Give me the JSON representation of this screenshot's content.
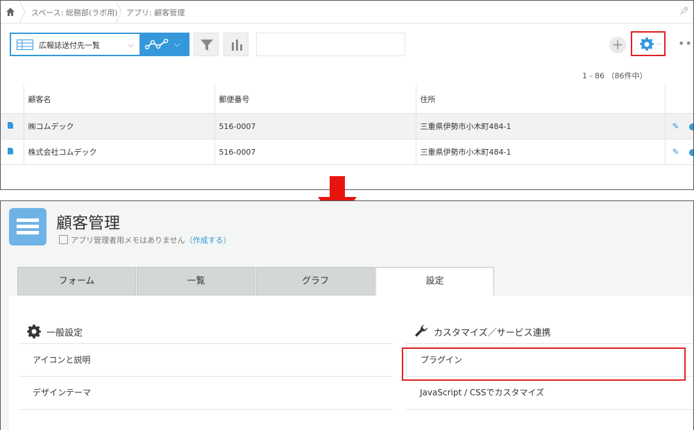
{
  "breadcrumb": {
    "space": "スペース: 総務部(ラボ用)",
    "app": "アプリ: 顧客管理"
  },
  "view": {
    "selected": "広報誌送付先一覧"
  },
  "pager": "1 - 86 （86件中）",
  "table": {
    "headers": [
      "顧客名",
      "郵便番号",
      "住所"
    ],
    "rows": [
      {
        "name": "㈱コムデック",
        "zip": "516-0007",
        "address": "三重県伊勢市小木町484-1"
      },
      {
        "name": "株式会社コムデック",
        "zip": "516-0007",
        "address": "三重県伊勢市小木町484-1"
      }
    ]
  },
  "settings": {
    "app_title": "顧客管理",
    "memo_text": "アプリ管理者用メモはありません",
    "memo_link": "（作成する）",
    "tabs": [
      "フォーム",
      "一覧",
      "グラフ",
      "設定"
    ],
    "active_tab": "設定",
    "general": {
      "heading": "一般設定",
      "items": [
        "アイコンと説明",
        "デザインテーマ"
      ]
    },
    "customize": {
      "heading": "カスタマイズ／サービス連携",
      "items": [
        "プラグイン",
        "JavaScript / CSSでカスタマイズ"
      ]
    }
  },
  "colors": {
    "accent": "#3498db",
    "highlight": "#e02020",
    "arrow": "#e8140e"
  }
}
